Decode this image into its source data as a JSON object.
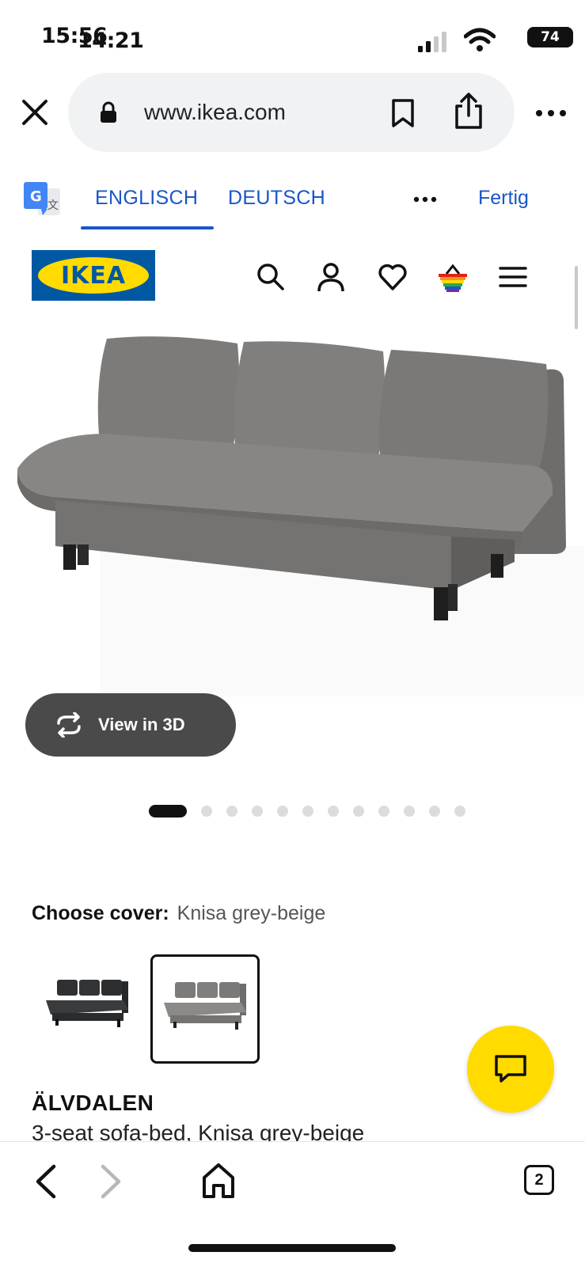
{
  "status_bar": {
    "time_primary": "15:56",
    "time_overlay": "14:21",
    "battery": "74",
    "icons": [
      "signal-icon",
      "wifi-icon",
      "battery-icon"
    ]
  },
  "browser": {
    "url": "www.ikea.com",
    "icons": [
      "close-icon",
      "lock-icon",
      "bookmark-icon",
      "share-icon",
      "more-icon"
    ]
  },
  "translate_bar": {
    "tabs": [
      {
        "label": "ENGLISCH",
        "active": true
      },
      {
        "label": "DEUTSCH",
        "active": false
      }
    ],
    "done_label": "Fertig",
    "icons": [
      "google-translate-icon",
      "more-icon"
    ]
  },
  "site_header": {
    "logo_text": "IKEA",
    "icons": [
      "search-icon",
      "profile-icon",
      "heart-icon",
      "shopping-bag-icon",
      "menu-icon"
    ]
  },
  "gallery": {
    "view3d_label": "View in 3D",
    "image_count": 12,
    "active_index": 0
  },
  "cover": {
    "label": "Choose cover:",
    "value": "Knisa grey-beige",
    "options": [
      {
        "name": "dark-grey",
        "color": "#3a3b3d",
        "selected": false
      },
      {
        "name": "grey-beige",
        "color": "#8c8a86",
        "selected": true
      }
    ]
  },
  "product": {
    "name": "ÄLVDALEN",
    "description": "3-seat sofa-bed, Knisa grey-beige"
  },
  "bottom_bar": {
    "tab_count": "2",
    "icons": [
      "back-icon",
      "forward-icon",
      "home-icon",
      "tabs-icon"
    ]
  },
  "colors": {
    "ikea_blue": "#0058a3",
    "ikea_yellow": "#ffdb00",
    "link_blue": "#1a56c8",
    "sofa_grey": "#7d7c7a"
  }
}
